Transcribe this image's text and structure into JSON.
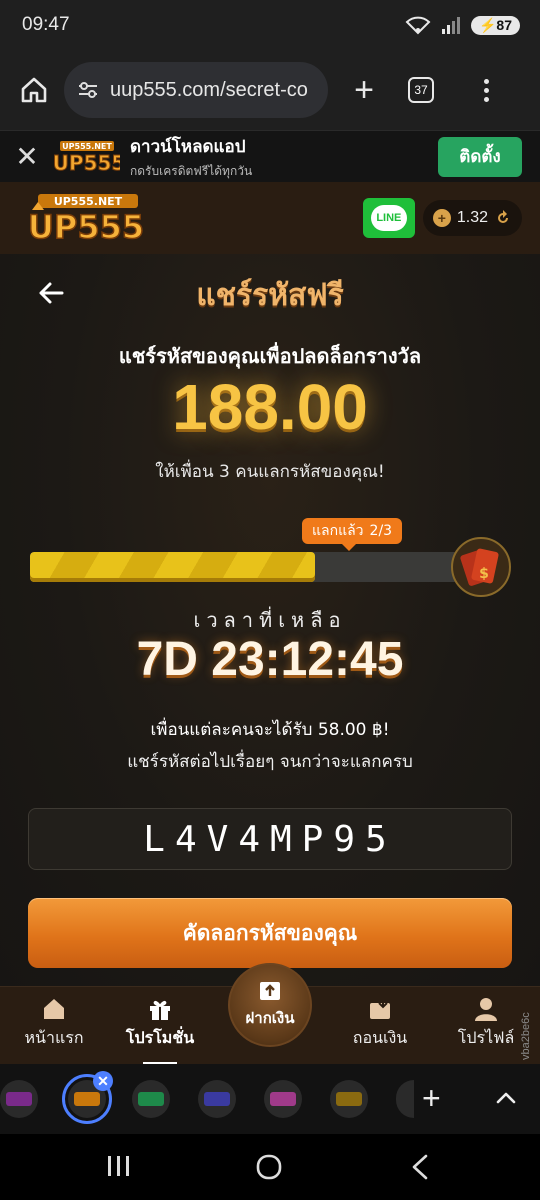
{
  "status": {
    "time": "09:47",
    "battery": "87"
  },
  "browser": {
    "url": "uup555.com/secret-co",
    "tab_count": "37"
  },
  "app_banner": {
    "title": "ดาวน์โหลดแอป",
    "subtitle": "กดรับเครดิตฟรีได้ทุกวัน",
    "install_label": "ติดตั้ง"
  },
  "header": {
    "logo_top": "UP555.NET",
    "logo_main": "UP555",
    "line_label": "LINE",
    "balance": "1.32"
  },
  "share": {
    "title": "แชร์รหัสฟรี",
    "subtitle": "แชร์รหัสของคุณเพื่อปลดล็อกรางวัล",
    "amount": "188.00",
    "invite_text": "ให้เพื่อน 3 คนแลกรหัสของคุณ!",
    "progress_label": "แลกแล้ว",
    "progress_count": "2/3",
    "progress_fraction": 0.6667,
    "time_label": "เวลาที่เหลือ",
    "countdown": "7D 23:12:45",
    "info_line1": "เพื่อนแต่ละคนจะได้รับ 58.00 ฿!",
    "info_line2": "แชร์รหัสต่อไปเรื่อยๆ จนกว่าจะแลกครบ",
    "code": "L4V4MP95",
    "copy_label": "คัดลอกรหัสของคุณ"
  },
  "nav": {
    "home": "หน้าแรก",
    "promotion": "โปรโมชั่น",
    "deposit": "ฝากเงิน",
    "withdraw": "ถอนเงิน",
    "profile": "โปรไฟล์"
  },
  "side_code": "vba2be6c",
  "colors": {
    "accent": "#f07a1a",
    "progress": "#e8c21a",
    "install": "#27a460",
    "line": "#1fbf3a",
    "tab_ring": "#4d7fff"
  }
}
